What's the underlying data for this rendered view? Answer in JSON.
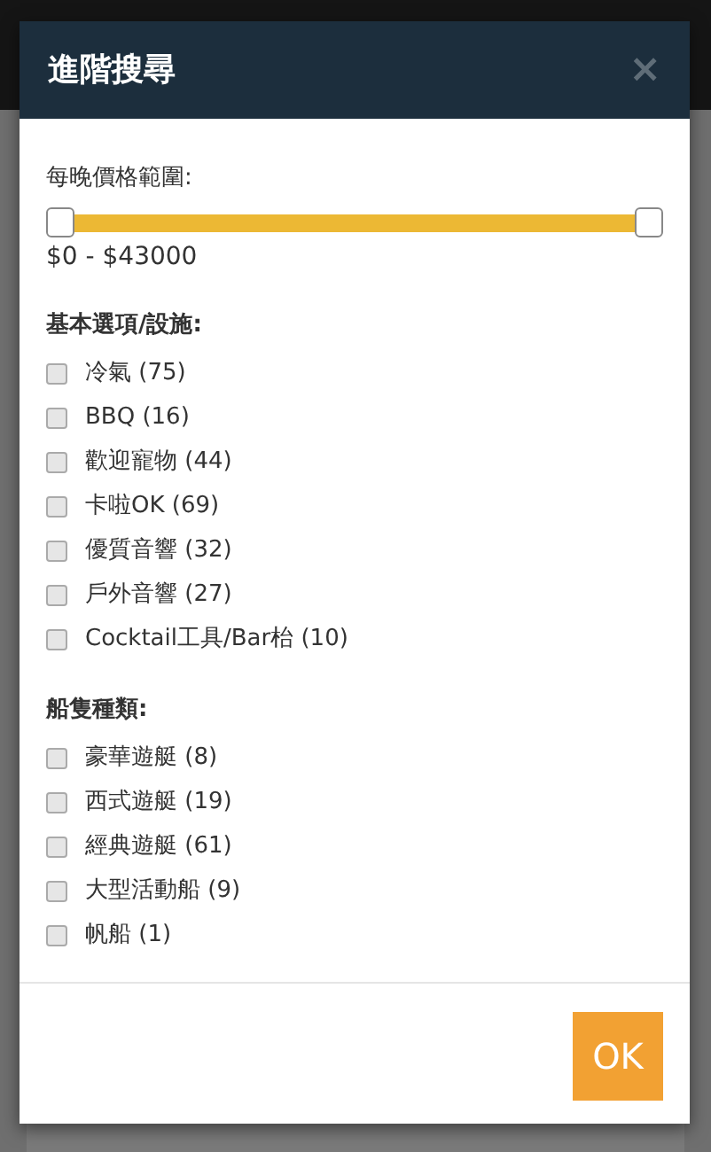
{
  "modal": {
    "title": "進階搜尋",
    "close": "×",
    "price": {
      "label": "每晚價格範圍:",
      "handles": [
        {
          "level": 0
        },
        {
          "level": 1
        }
      ],
      "reading": "$0 - $43000"
    },
    "groups": [
      {
        "heading": "基本選項/設施:",
        "options": [
          {
            "label": "冷氣 (75)",
            "checked": false
          },
          {
            "label": "BBQ (16)",
            "checked": false
          },
          {
            "label": "歡迎寵物 (44)",
            "checked": false
          },
          {
            "label": "卡啦OK (69)",
            "checked": false
          },
          {
            "label": "優質音響 (32)",
            "checked": false
          },
          {
            "label": "戶外音響 (27)",
            "checked": false
          },
          {
            "label": "Cocktail工具/Bar枱 (10)",
            "checked": false
          }
        ]
      },
      {
        "heading": "船隻種類:",
        "options": [
          {
            "label": "豪華遊艇 (8)",
            "checked": false
          },
          {
            "label": "西式遊艇 (19)",
            "checked": false
          },
          {
            "label": "經典遊艇 (61)",
            "checked": false
          },
          {
            "label": "大型活動船 (9)",
            "checked": false
          },
          {
            "label": "帆船 (1)",
            "checked": false
          }
        ]
      }
    ],
    "ok_button": "OK"
  }
}
